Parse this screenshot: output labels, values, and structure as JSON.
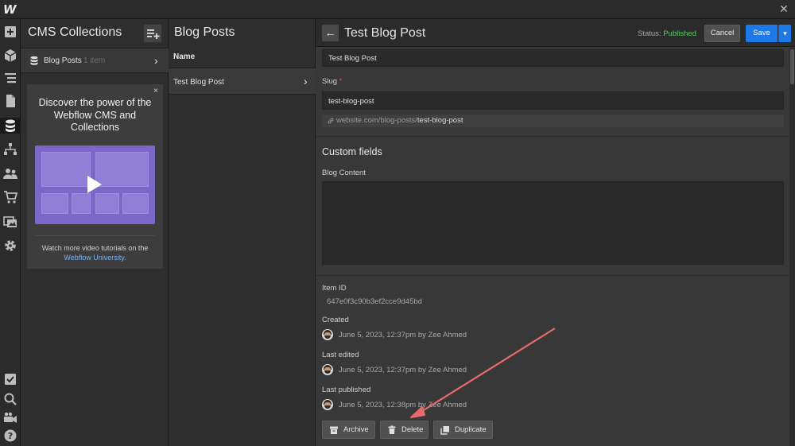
{
  "app": {
    "logo": "W",
    "close_glyph": "✕"
  },
  "collections_panel": {
    "title": "CMS Collections",
    "items": [
      {
        "name": "Blog Posts",
        "count": "1 item"
      }
    ],
    "promo": {
      "close_glyph": "×",
      "title": "Discover the power of the Webflow CMS and Collections",
      "body": "Watch more video tutorials on the",
      "link": "Webflow University."
    }
  },
  "posts_panel": {
    "title": "Blog Posts",
    "column_header": "Name",
    "rows": [
      {
        "name": "Test Blog Post"
      }
    ]
  },
  "editor": {
    "title": "Test Blog Post",
    "status_label": "Status:",
    "status_value": "Published",
    "cancel_label": "Cancel",
    "save_label": "Save",
    "name_value": "Test Blog Post",
    "slug_label": "Slug",
    "slug_required": "*",
    "slug_value": "test-blog-post",
    "url_prefix": "website.com/blog-posts/",
    "url_slug": "test-blog-post",
    "custom_fields_title": "Custom fields",
    "blog_content_label": "Blog Content",
    "item_id_label": "Item ID",
    "item_id_value": "647e0f3c90b3ef2cce9d45bd",
    "created_label": "Created",
    "created_value": "June 5, 2023, 12:37pm by Zee Ahmed",
    "last_edited_label": "Last edited",
    "last_edited_value": "June 5, 2023, 12:37pm by Zee Ahmed",
    "last_published_label": "Last published",
    "last_published_value": "June 5, 2023, 12:38pm by Zee Ahmed",
    "archive_label": "Archive",
    "delete_label": "Delete",
    "duplicate_label": "Duplicate"
  },
  "colors": {
    "accent_blue": "#1e78e6",
    "published_green": "#5cc96a",
    "annotation_arrow": "#e86a6a",
    "promo_purple": "#7a67c7"
  },
  "icons": {
    "left_toolbar": [
      "add-icon",
      "box-icon",
      "navigator-icon",
      "pages-icon",
      "cms-icon",
      "sitemap-icon",
      "users-icon",
      "ecommerce-icon",
      "assets-icon",
      "settings-icon",
      "checklist-icon",
      "search-icon",
      "video-icon",
      "help-icon"
    ]
  }
}
